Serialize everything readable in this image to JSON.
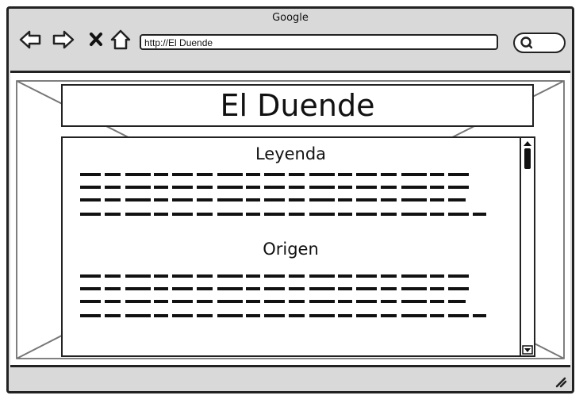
{
  "browser": {
    "title": "Google",
    "url": "http://El Duende",
    "icons": [
      "back-arrow-icon",
      "forward-arrow-icon",
      "close-icon",
      "home-icon",
      "search-icon"
    ]
  },
  "page": {
    "heading": "El Duende",
    "sections": [
      {
        "title": "Leyenda"
      },
      {
        "title": "Origen"
      }
    ]
  },
  "colors": {
    "frame": "#222222",
    "chrome": "#d9d9d9",
    "content": "#ffffff"
  }
}
